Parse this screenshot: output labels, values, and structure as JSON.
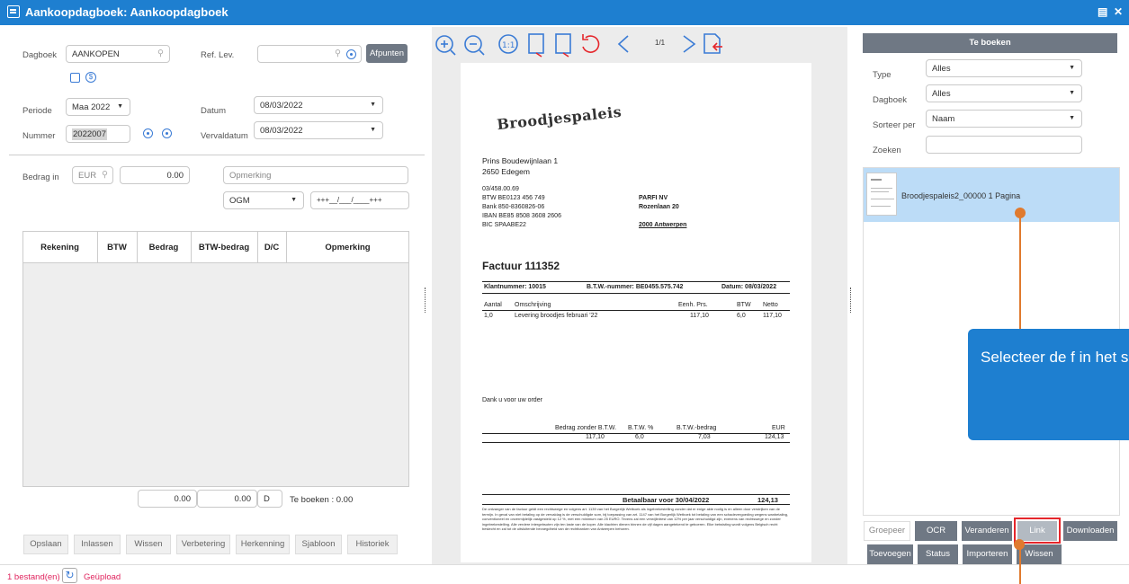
{
  "window": {
    "title": "Aankoopdagboek: Aankoopdagboek",
    "restore_icon": "restore-icon",
    "close_icon": "close-icon"
  },
  "form": {
    "dagboek_label": "Dagboek",
    "dagboek_value": "AANKOPEN",
    "ref_lev_label": "Ref. Lev.",
    "afpunten_label": "Afpunten",
    "periode_label": "Periode",
    "periode_value": "Maa 2022",
    "datum_label": "Datum",
    "datum_value": "08/03/2022",
    "nummer_label": "Nummer",
    "nummer_value": "2022007",
    "vervaldatum_label": "Vervaldatum",
    "vervaldatum_value": "08/03/2022",
    "bedrag_label": "Bedrag in",
    "currency": "EUR",
    "bedrag_value": "0.00",
    "opmerking_placeholder": "Opmerking",
    "ogm_value": "OGM",
    "ogm_structured": "+++__/___/____+++"
  },
  "table": {
    "headers": [
      "Rekening",
      "BTW",
      "Bedrag",
      "BTW-bedrag",
      "D/C",
      "Opmerking"
    ],
    "total_bedrag": "0.00",
    "total_btw": "0.00",
    "total_dc": "D",
    "te_boeken": "Te boeken : 0.00"
  },
  "actions": [
    "Opslaan",
    "Inlassen",
    "Wissen",
    "Verbetering",
    "Herkenning",
    "Sjabloon",
    "Historiek"
  ],
  "status": {
    "files": "1 bestand(en)",
    "uploaded": "Geüpload"
  },
  "viewer": {
    "page_indicator": "1/1"
  },
  "document": {
    "logo": "Broodjespaleis",
    "sender_street": "Prins Boudewijnlaan 1",
    "sender_city": "2650 Edegem",
    "sender_lines": [
      "03/458.00.69",
      "BTW BE0123 456 749",
      "Bank 850-8360826-06",
      "IBAN BE85 8508 3608 2606",
      "BIC SPAABE22"
    ],
    "recipient_name": "PARFI NV",
    "recipient_street": "Rozenlaan 20",
    "recipient_city": "2000 Antwerpen",
    "invoice_title": "Factuur 111352",
    "klantnummer": "Klantnummer: 10015",
    "btw_nummer": "B.T.W.-nummer: BE0455.575.742",
    "datum": "Datum: 08/03/2022",
    "line_headers": [
      "Aantal",
      "Omschrijving",
      "Eenh. Prs.",
      "BTW",
      "Netto"
    ],
    "line_values": [
      "1,0",
      "Levering broodjes februari '22",
      "117,10",
      "6,0",
      "117,10"
    ],
    "thanks": "Dank u voor uw order",
    "sum_headers": [
      "Bedrag zonder B.T.W.",
      "B.T.W. %",
      "B.T.W.-bedrag",
      "EUR"
    ],
    "sum_values": [
      "117,10",
      "6,0",
      "7,03",
      "124,13"
    ],
    "due_label": "Betaalbaar voor 30/04/2022",
    "due_amount": "124,13",
    "fine_print": "De ontvanger van de factuur geldt een rechtswege en volgens art. 1139 van het Burgerlijk Wetboek als ingebrekestelling zonder dat er enige akte nodig is en alleen door verstrijken van de termijn. In geval van niet betaling op de vervaldag is de verschuldigde som, bij toepassing van art. 1147 van het Burgerlijk Wetboek tot betaling van een schadevergoeding wegens wanbetaling, conventioneel en onvermijdelijk vastgesteld op 12 %, met een minimum van 25 EURO. Tevens zal een verwijlintrest van 12% per jaar verschuldigd zijn, evenens van rechtswege en zonder ingebrekestelling. Alle verdere intergebsoten zijn ten laste van de koper. Alle klachten dienen binnen de vijf dagen aangetekend te geboeren. Elke betwisting wordt volgens Belgisch recht beslecht en zal tot de uitsluitende bevoegdheid van de rechtbanken van Antwerpen behoren."
  },
  "right_panel": {
    "title": "Te boeken",
    "type_label": "Type",
    "type_value": "Alles",
    "dagboek_label": "Dagboek",
    "dagboek_value": "Alles",
    "sorteer_label": "Sorteer per",
    "sorteer_value": "Naam",
    "zoeken_label": "Zoeken",
    "file_item": "Broodjespaleis2_00000 1 Pagina",
    "buttons_row1": [
      "Groepeer",
      "OCR",
      "Veranderen",
      "Link",
      "Downloaden"
    ],
    "buttons_row2": [
      "Toevoegen",
      "Status",
      "Importeren",
      "Wissen"
    ]
  },
  "callout": {
    "text": "Selecteer de f in het scherm"
  },
  "colors": {
    "titlebar": "#1e7fd0",
    "callout": "#1e7fd0",
    "selected": "#bcdcf7",
    "highlight": "#e5262b",
    "pointer": "#e07a2e",
    "accent_text": "#e0245e"
  }
}
